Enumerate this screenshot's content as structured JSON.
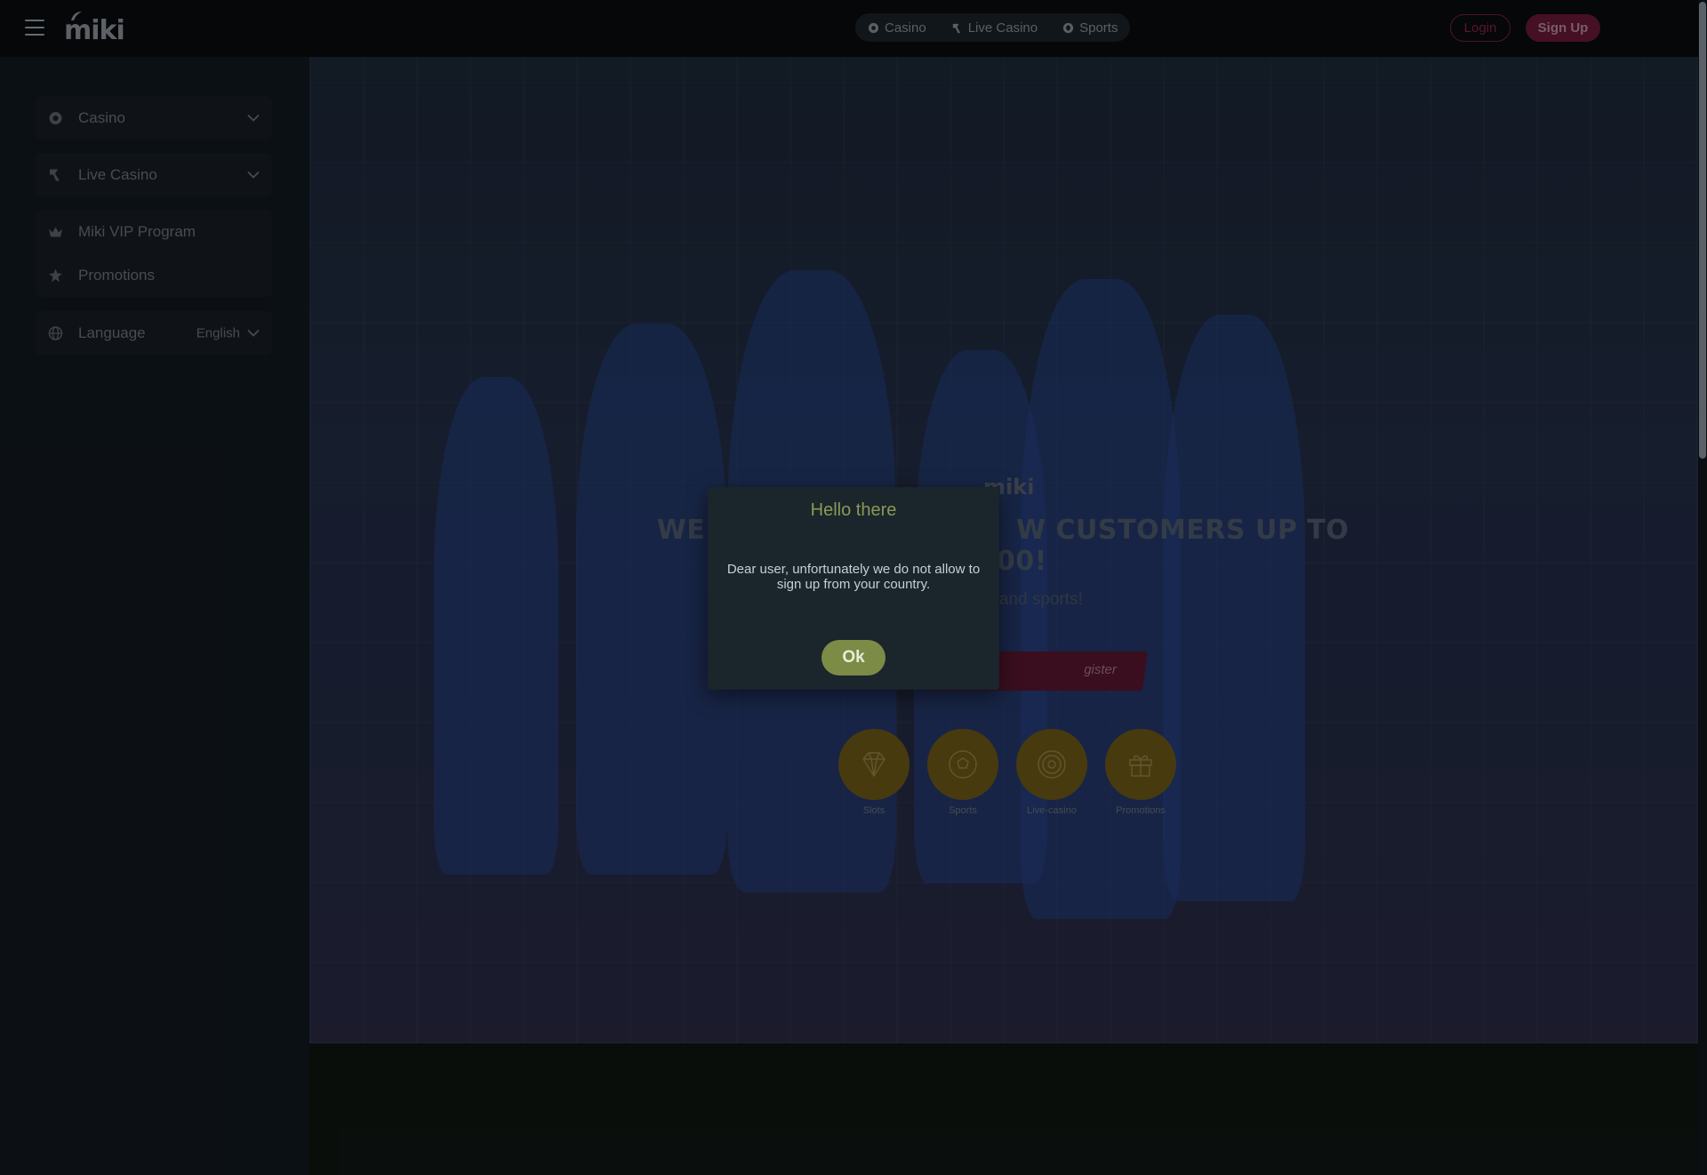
{
  "header": {
    "logo_text": "miki",
    "nav": [
      {
        "label": "Casino",
        "icon": "casino-chip-icon"
      },
      {
        "label": "Live Casino",
        "icon": "live-casino-icon"
      },
      {
        "label": "Sports",
        "icon": "sports-ball-icon"
      }
    ],
    "login_label": "Login",
    "signup_label": "Sign Up"
  },
  "sidebar": {
    "items": [
      {
        "label": "Casino",
        "icon": "casino-chip-icon"
      },
      {
        "label": "Live Casino",
        "icon": "live-casino-icon"
      },
      {
        "label": "Miki VIP Program",
        "icon": "crown-icon"
      },
      {
        "label": "Promotions",
        "icon": "promotions-icon"
      }
    ],
    "language_label": "Language",
    "language_value": "English"
  },
  "hero": {
    "logo_text": "miki",
    "title_left": "WEL",
    "title_right": "W CUSTOMERS UP TO $600!",
    "subtitle_fragment": "o and sports!",
    "register_fragment": "gister",
    "quick_links": [
      {
        "label": "Slots",
        "icon": "diamond-icon"
      },
      {
        "label": "Sports",
        "icon": "soccer-ball-icon"
      },
      {
        "label": "Live-casino",
        "icon": "roulette-icon"
      },
      {
        "label": "Promotions",
        "icon": "gift-icon"
      }
    ]
  },
  "modal": {
    "title": "Hello there",
    "message": "Dear user, unfortunately we do not allow to sign up from your country.",
    "ok_label": "Ok"
  },
  "colors": {
    "accent_green": "#7c8b46",
    "brand_red": "#6a1838",
    "gold": "#6e5a18"
  }
}
